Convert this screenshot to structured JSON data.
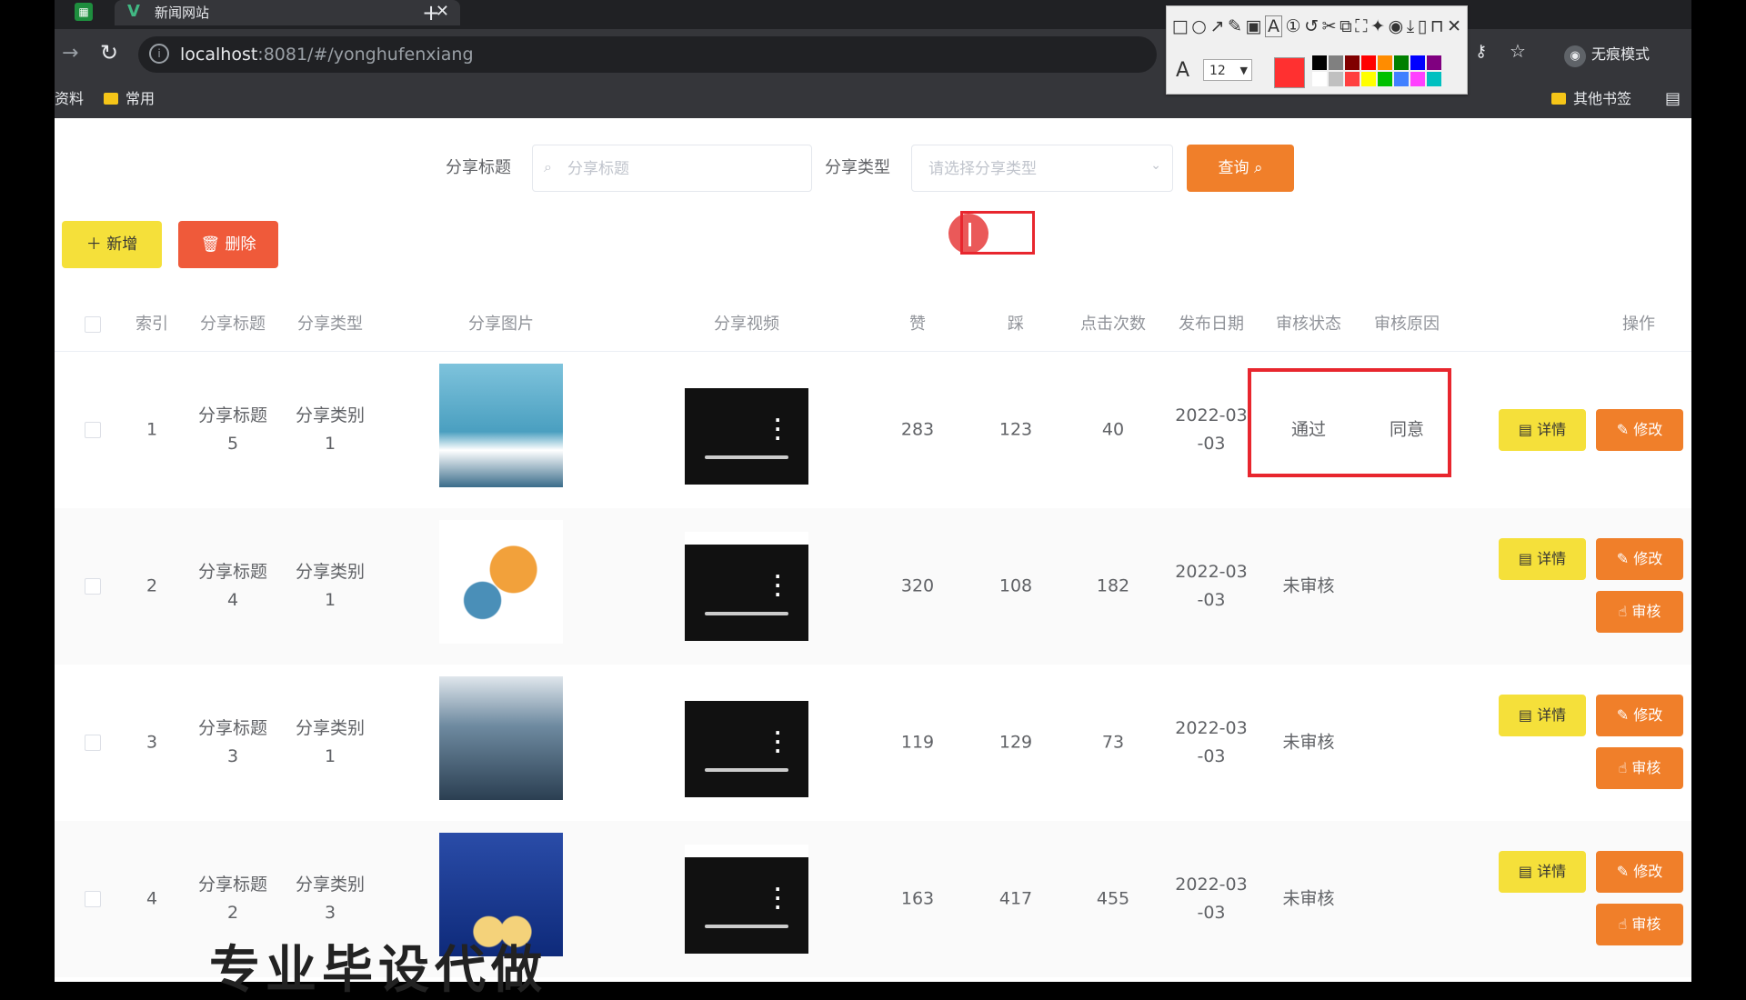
{
  "browser": {
    "tab_title": "新闻网站",
    "tab_close": "✕",
    "new_tab": "+",
    "url_host": "localhost",
    "url_rest": ":8081/#/yonghufenxiang",
    "profile_label": "无痕模式",
    "bookmarks": [
      "资料",
      "常用"
    ],
    "bookmarks_right": "其他书签"
  },
  "annotation_toolbar": {
    "font_size": "12",
    "current_color": "#ff3030",
    "palette": [
      "#000000",
      "#808080",
      "#800000",
      "#ff0000",
      "#ff8c00",
      "#008000",
      "#0000ff",
      "#800080",
      "#ffffff",
      "#c0c0c0",
      "#ff4040",
      "#ffff00",
      "#00c000",
      "#4080ff",
      "#ff40ff",
      "#00c0c0"
    ]
  },
  "search": {
    "title_label": "分享标题",
    "title_placeholder": "分享标题",
    "type_label": "分享类型",
    "type_placeholder": "请选择分享类型",
    "query_button": "查询"
  },
  "actions": {
    "add_button": "新增",
    "delete_button": "删除"
  },
  "table": {
    "headers": {
      "index": "索引",
      "title": "分享标题",
      "type": "分享类型",
      "image": "分享图片",
      "video": "分享视频",
      "like": "赞",
      "dislike": "踩",
      "clicks": "点击次数",
      "date": "发布日期",
      "status": "审核状态",
      "reason": "审核原因",
      "ops": "操作"
    },
    "detail_label": "详情",
    "edit_label": "修改",
    "review_label": "审核",
    "rows": [
      {
        "index": "1",
        "title1": "分享标题",
        "title2": "5",
        "type1": "分享类别",
        "type2": "1",
        "like": "283",
        "dislike": "123",
        "clicks": "40",
        "date1": "2022-03",
        "date2": "-03",
        "status": "通过",
        "reason": "同意"
      },
      {
        "index": "2",
        "title1": "分享标题",
        "title2": "4",
        "type1": "分享类别",
        "type2": "1",
        "like": "320",
        "dislike": "108",
        "clicks": "182",
        "date1": "2022-03",
        "date2": "-03",
        "status": "未审核",
        "reason": ""
      },
      {
        "index": "3",
        "title1": "分享标题",
        "title2": "3",
        "type1": "分享类别",
        "type2": "1",
        "like": "119",
        "dislike": "129",
        "clicks": "73",
        "date1": "2022-03",
        "date2": "-03",
        "status": "未审核",
        "reason": ""
      },
      {
        "index": "4",
        "title1": "分享标题",
        "title2": "2",
        "type1": "分享类别",
        "type2": "3",
        "like": "163",
        "dislike": "417",
        "clicks": "455",
        "date1": "2022-03",
        "date2": "-03",
        "status": "未审核",
        "reason": ""
      }
    ]
  },
  "overlay_caption": "专业毕设代做"
}
